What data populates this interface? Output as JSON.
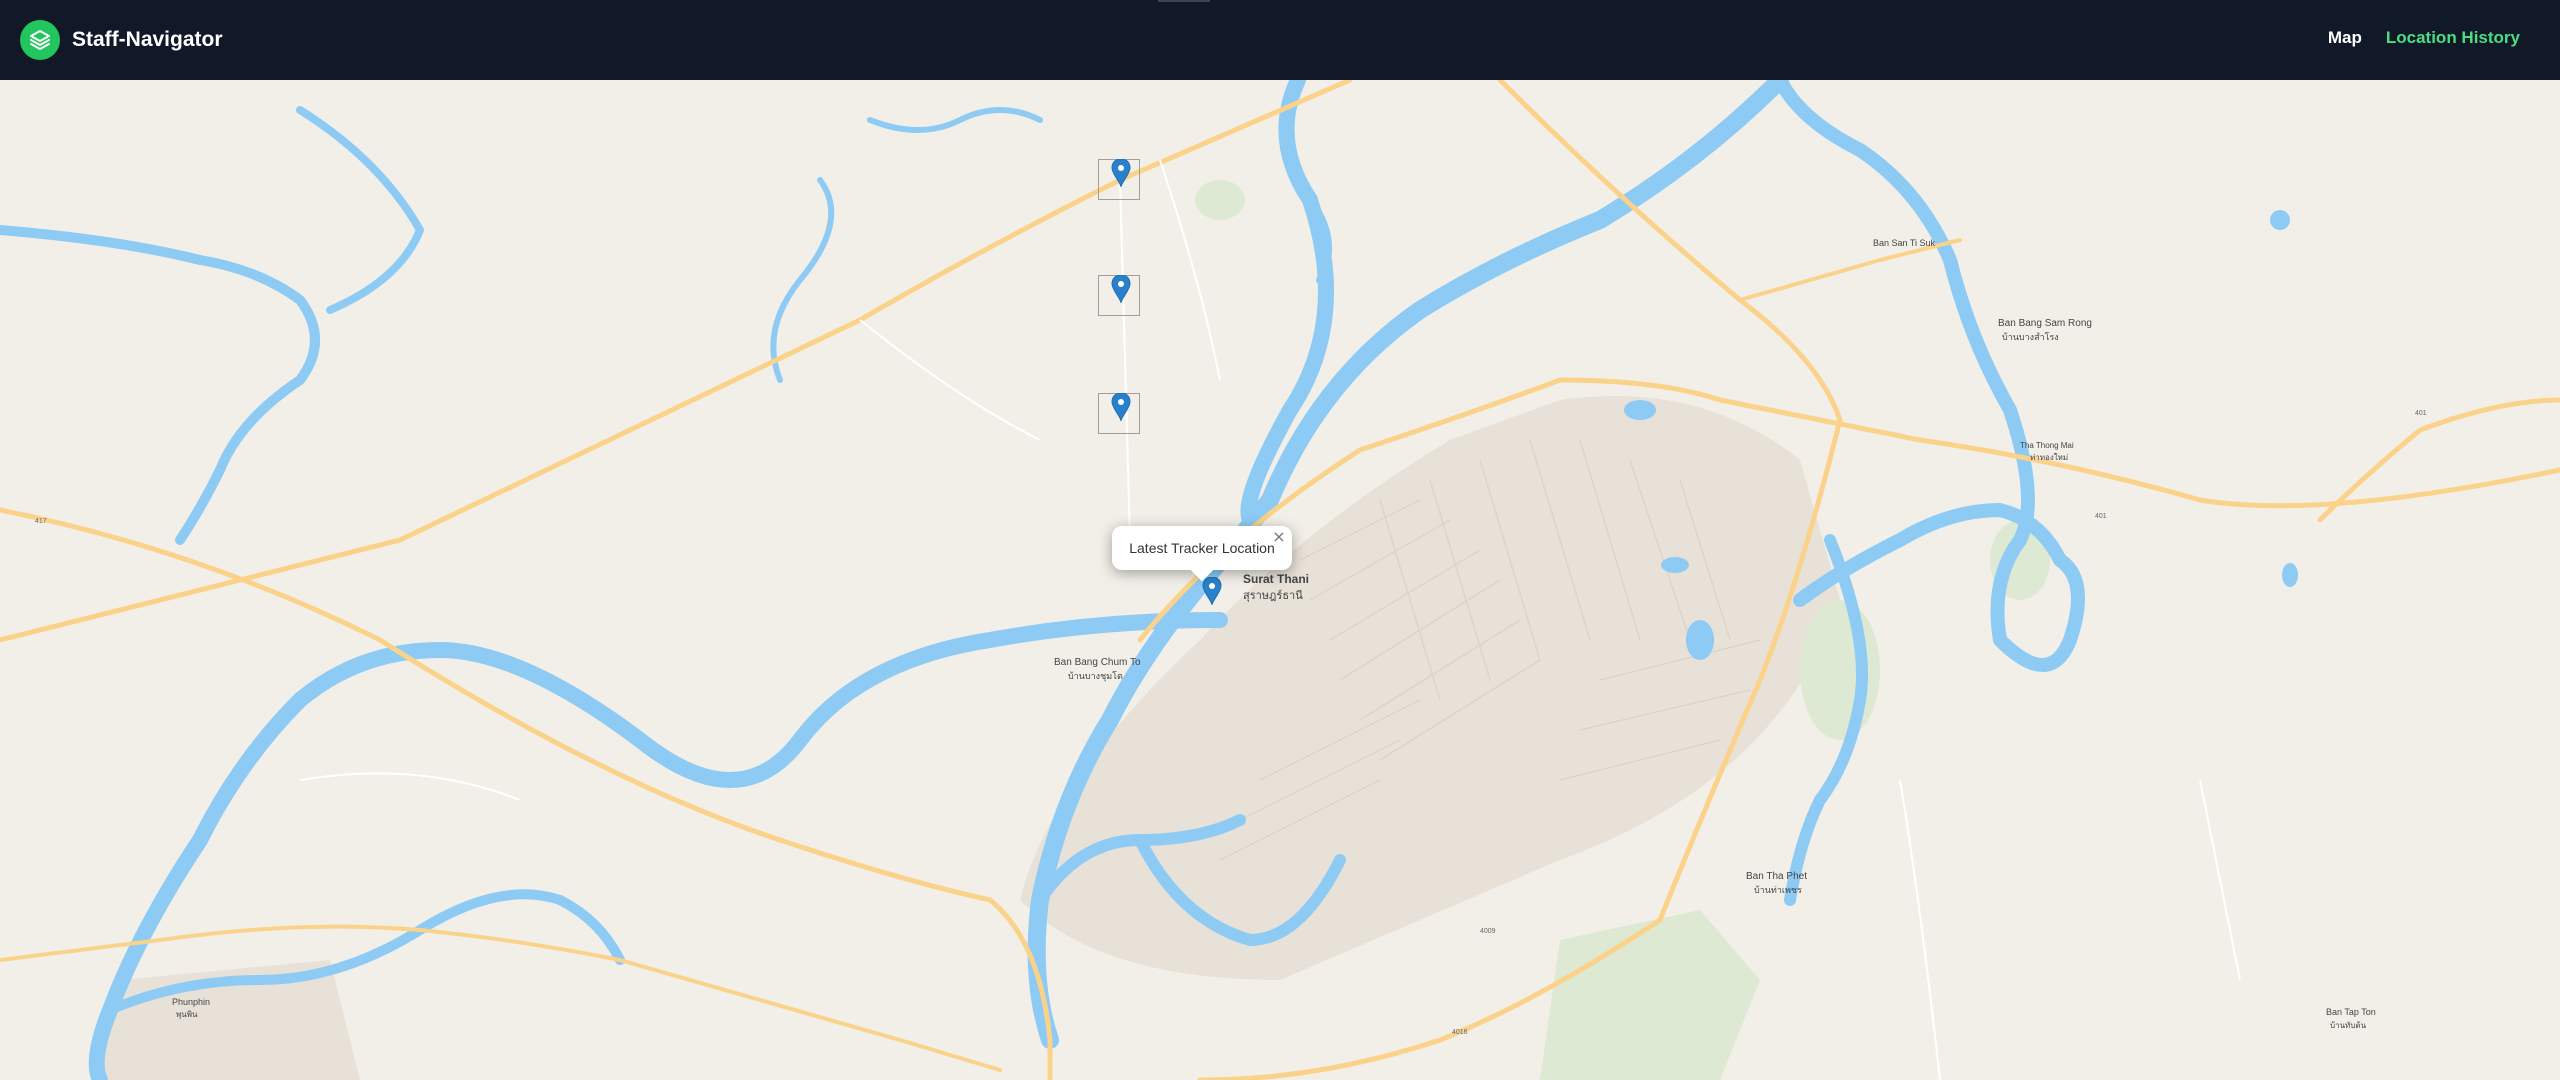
{
  "navbar": {
    "brand": {
      "name": "Staff-Navigator",
      "icon": "layers-icon"
    },
    "links": [
      {
        "label": "Map",
        "color": "#ffffff"
      },
      {
        "label": "Location History",
        "color": "#4ade80"
      }
    ]
  },
  "map": {
    "popup": {
      "text": "Latest Tracker Location",
      "close": "×"
    },
    "marker_color": "#2a81cb",
    "water_color": "#8dcbf5",
    "road_color": "#fddc8f",
    "markers": [
      {
        "name": "history-marker-1"
      },
      {
        "name": "history-marker-2"
      },
      {
        "name": "history-marker-3"
      },
      {
        "name": "latest-tracker-marker"
      }
    ],
    "places": {
      "surat_thani": "Surat Thani",
      "surat_thani_th": "สุราษฎร์ธานี",
      "ban_bang_chum_to": "Ban Bang Chum To",
      "ban_bang_chum_to_th": "บ้านบางชุมโต",
      "ban_san_ti_suk": "Ban San Ti Suk",
      "ban_bang_sam_rong": "Ban Bang Sam Rong",
      "ban_bang_sam_rong_th": "บ้านบางสำโรง",
      "tha_thong_mai": "Tha Thong Mai",
      "tha_thong_mai_th": "ท่าทองใหม่",
      "ban_tha_phet": "Ban Tha Phet",
      "ban_tha_phet_th": "บ้านท่าเพชร",
      "phunphin": "Phunphin",
      "phunphin_th": "พุนพิน",
      "ban_tap_ton": "Ban Tap Ton",
      "ban_tap_ton_th": "บ้านทับต้น"
    },
    "roads": {
      "r401": "401",
      "r417": "417",
      "r4009": "4009",
      "r4016": "4016"
    }
  }
}
